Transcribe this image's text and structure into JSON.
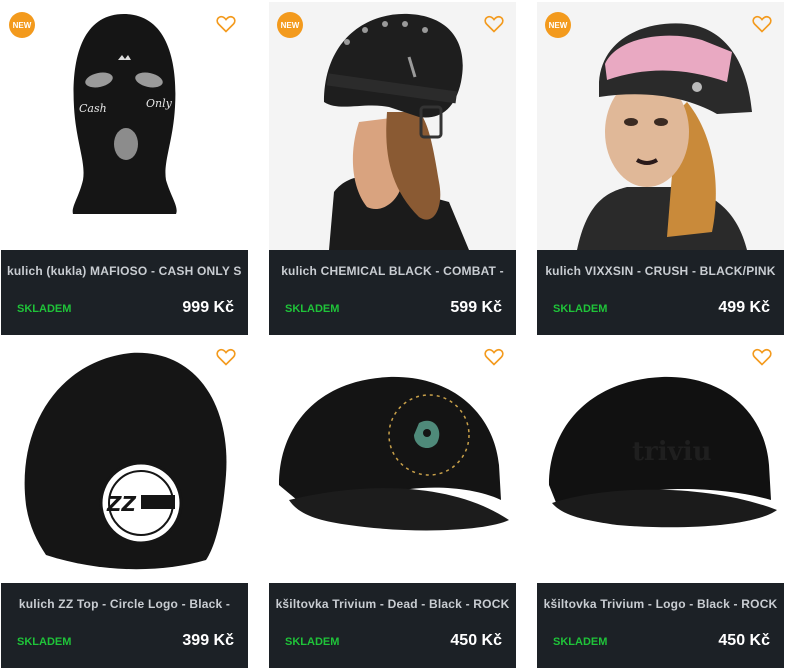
{
  "colors": {
    "card_bg": "#1c2126",
    "badge": "#f39a1d",
    "heart": "#f39a1d",
    "in_stock": "#1fc339",
    "title": "#c9cdd2",
    "price": "#ffffff"
  },
  "icons": {
    "wishlist": "heart-outline-icon"
  },
  "products": [
    {
      "badge": "NEW",
      "title": "kulich (kukla) MAFIOSO - CASH ONLY SKI",
      "stock": "SKLADEM",
      "price": "999 Kč"
    },
    {
      "badge": "NEW",
      "title": "kulich CHEMICAL BLACK - COMBAT -",
      "stock": "SKLADEM",
      "price": "599 Kč"
    },
    {
      "badge": "NEW",
      "title": "kulich VIXXSIN - CRUSH - BLACK/PINK",
      "stock": "SKLADEM",
      "price": "499 Kč"
    },
    {
      "title": "kulich ZZ Top - Circle Logo - Black -",
      "stock": "SKLADEM",
      "price": "399 Kč"
    },
    {
      "title": "kšiltovka Trivium - Dead - Black - ROCK",
      "stock": "SKLADEM",
      "price": "450 Kč"
    },
    {
      "title": "kšiltovka Trivium - Logo - Black - ROCK",
      "stock": "SKLADEM",
      "price": "450 Kč"
    }
  ]
}
